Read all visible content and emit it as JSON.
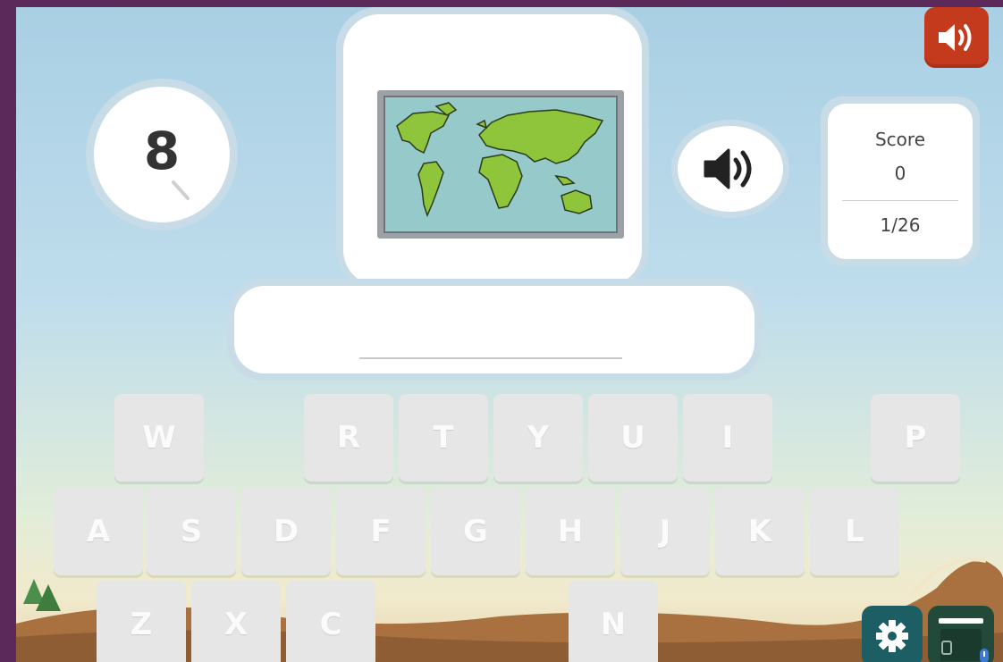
{
  "timer": {
    "value": "8"
  },
  "prompt": {
    "image_icon": "world-map-icon"
  },
  "score": {
    "label": "Score",
    "value": "0",
    "progress": "1/26"
  },
  "answer": {
    "value": ""
  },
  "keyboard": {
    "row1": [
      "W",
      "R",
      "T",
      "Y",
      "U",
      "I",
      "P"
    ],
    "row2": [
      "A",
      "S",
      "D",
      "F",
      "G",
      "H",
      "J",
      "K",
      "L"
    ],
    "row3": [
      "Z",
      "X",
      "C",
      "N"
    ]
  },
  "controls": {
    "sound_toggle_icon": "speaker-icon",
    "play_audio_icon": "speaker-icon",
    "settings_icon": "gear-icon",
    "hat_icon": "hat-icon"
  },
  "colors": {
    "sound_toggle": "#c33a1c",
    "settings": "#1d5e64",
    "hat_button": "#23493a",
    "map_land": "#8fc53b",
    "map_water": "#96c9c9"
  }
}
